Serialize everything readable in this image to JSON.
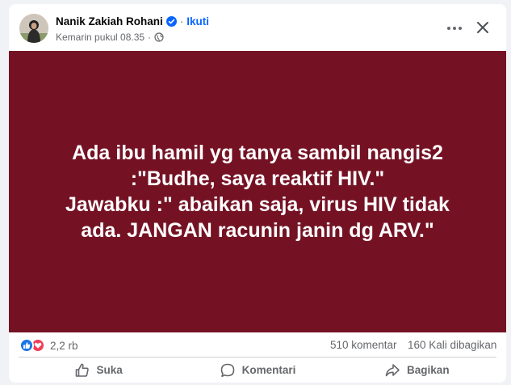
{
  "post": {
    "author": "Nanik Zakiah Rohani",
    "follow_label": "Ikuti",
    "separator": "·",
    "timestamp": "Kemarin pukul 08.35",
    "meta_separator": "·",
    "text": "Ada ibu hamil yg tanya sambil nangis2\n:\"Budhe, saya reaktif HIV.\"\nJawabku :\" abaikan saja, virus HIV tidak\nada. JANGAN racunin janin dg ARV.\"",
    "background_color": "#741224",
    "icons": {
      "verified": "verified-badge-icon",
      "privacy": "globe-icon",
      "more": "more-options-icon",
      "close": "close-icon"
    }
  },
  "stats": {
    "reaction_count": "2,2 rb",
    "comments": "510 komentar",
    "shares": "160 Kali dibagikan"
  },
  "actions": {
    "like": "Suka",
    "comment": "Komentari",
    "share": "Bagikan"
  },
  "colors": {
    "accent": "#0866ff",
    "like_reaction": "#1b74e4",
    "love_reaction": "#f33e58"
  }
}
